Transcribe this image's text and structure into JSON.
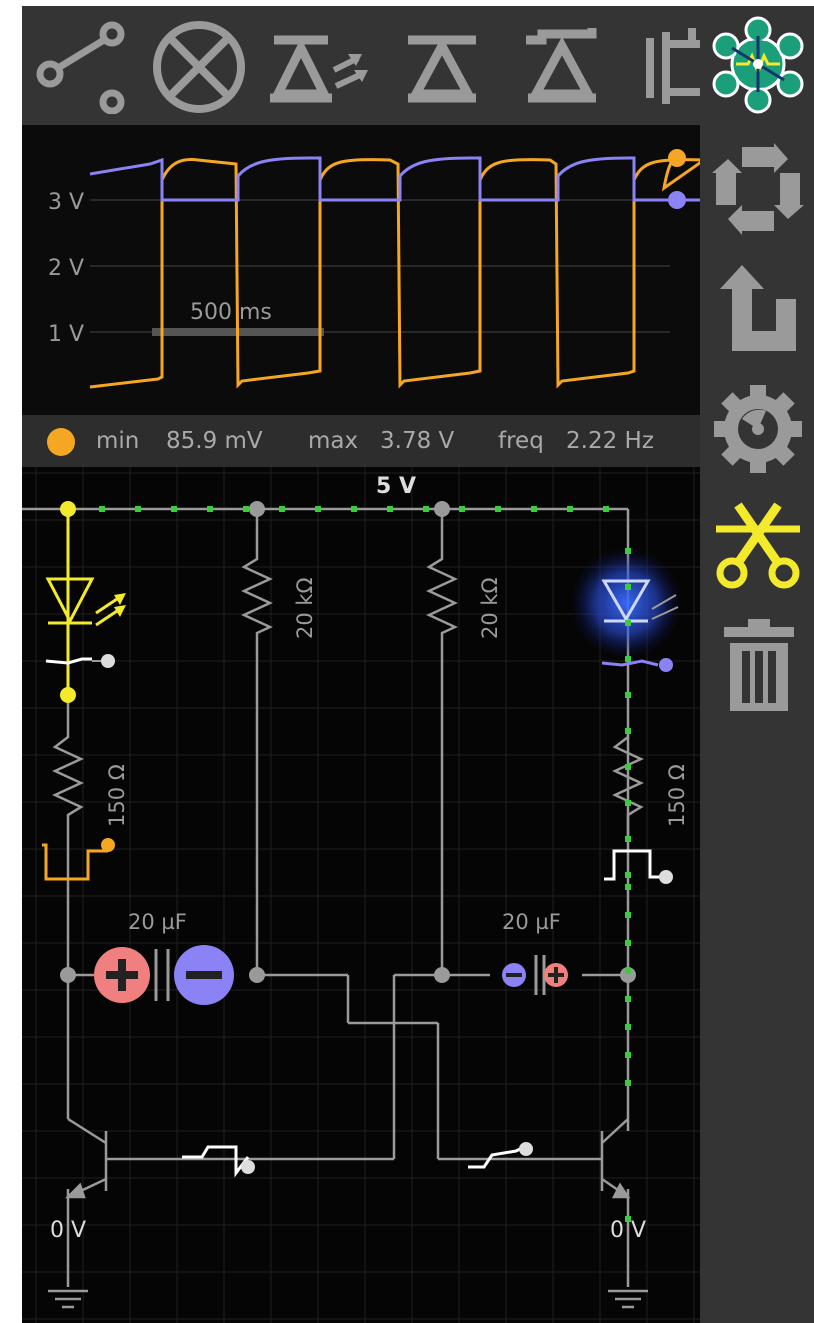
{
  "toolbar": {
    "items": [
      "wire-tool",
      "lamp-tool",
      "led-tool",
      "diode-tool",
      "zener-diode-tool",
      "mosfet-tool",
      "app-logo"
    ]
  },
  "sidebar": {
    "items": [
      "rotate-tool",
      "flip-tool",
      "settings-tool",
      "cut-tool",
      "delete-tool"
    ],
    "active": "cut-tool"
  },
  "scope": {
    "y_ticks": [
      "3 V",
      "2 V",
      "1 V"
    ],
    "time_scale": "500 ms",
    "colors": {
      "trace_a": "#f5a623",
      "trace_b": "#8b83f5"
    }
  },
  "status": {
    "min_label": "min",
    "min_value": "85.9 mV",
    "max_label": "max",
    "max_value": "3.78 V",
    "freq_label": "freq",
    "freq_value": "2.22 Hz",
    "probe_color": "#f5a623"
  },
  "circuit": {
    "supply_label": "5 V",
    "resistor_left_mid": "20 kΩ",
    "resistor_right_mid": "20 kΩ",
    "resistor_left_led": "150 Ω",
    "resistor_right_led": "150 Ω",
    "cap_left": "20 µF",
    "cap_right": "20 µF",
    "ground_left": "0 V",
    "ground_right": "0 V",
    "colors": {
      "led_left": "#f2ea2a",
      "led_right": "#3a6cff",
      "wire": "#9a9a9a",
      "current_dot": "#3bcc3b"
    }
  }
}
